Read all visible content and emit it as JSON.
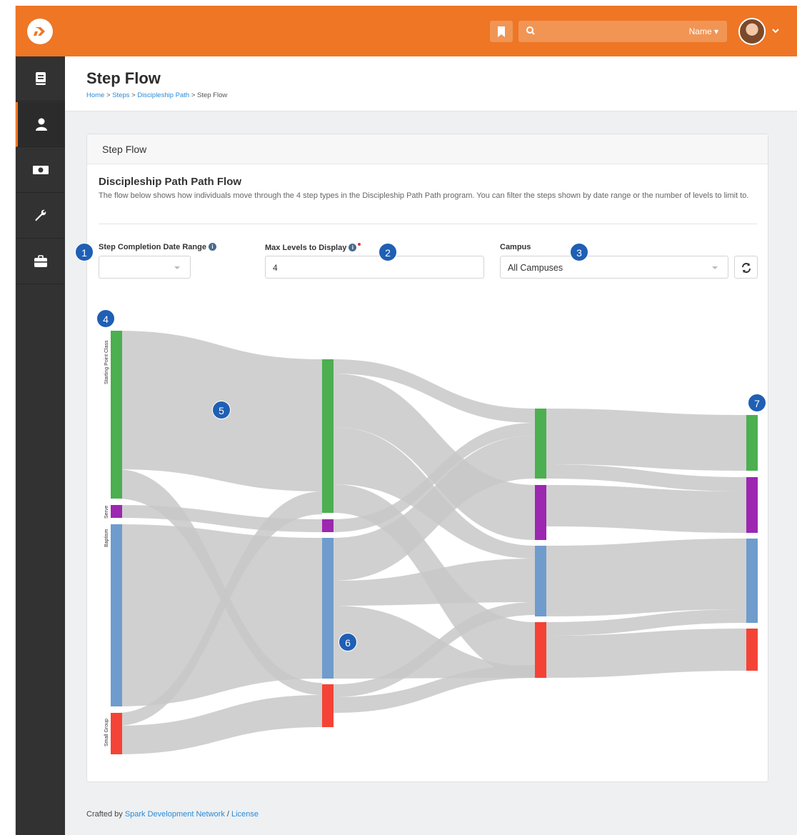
{
  "header": {
    "search_filter": "Name ▾"
  },
  "page": {
    "title": "Step Flow",
    "breadcrumb": [
      {
        "label": "Home",
        "link": true
      },
      {
        "label": "Steps",
        "link": true
      },
      {
        "label": "Discipleship Path",
        "link": true
      },
      {
        "label": "Step Flow",
        "link": false
      }
    ],
    "breadcrumb_sep": ">"
  },
  "panel": {
    "title": "Step Flow",
    "flow_title": "Discipleship Path Path Flow",
    "flow_description": "The flow below shows how individuals move through the 4 step types in the Discipleship Path Path program. You can filter the steps shown by date range or the number of levels to limit to."
  },
  "filters": {
    "date_range_label": "Step Completion Date Range",
    "date_range_value": "",
    "max_levels_label": "Max Levels to Display",
    "max_levels_value": "4",
    "campus_label": "Campus",
    "campus_value": "All Campuses"
  },
  "badges": [
    "1",
    "2",
    "3",
    "4",
    "5",
    "6",
    "7"
  ],
  "colors": {
    "brand": "#ee7625",
    "green": "#4caf50",
    "purple": "#9c27b0",
    "blue": "#6f9ccc",
    "red": "#f44336",
    "link": "#cccccc",
    "badge": "#1f5fb4"
  },
  "chart_data": {
    "type": "sankey",
    "levels": 4,
    "step_types": [
      "Starting Point Class",
      "Serve",
      "Baptism",
      "Small Group"
    ],
    "nodes_level1_labels": [
      "Starting Point Class",
      "Serve",
      "Baptism",
      "Small Group"
    ]
  },
  "footer": {
    "prefix": "Crafted by",
    "org": "Spark Development Network",
    "sep": "/",
    "license": "License"
  }
}
